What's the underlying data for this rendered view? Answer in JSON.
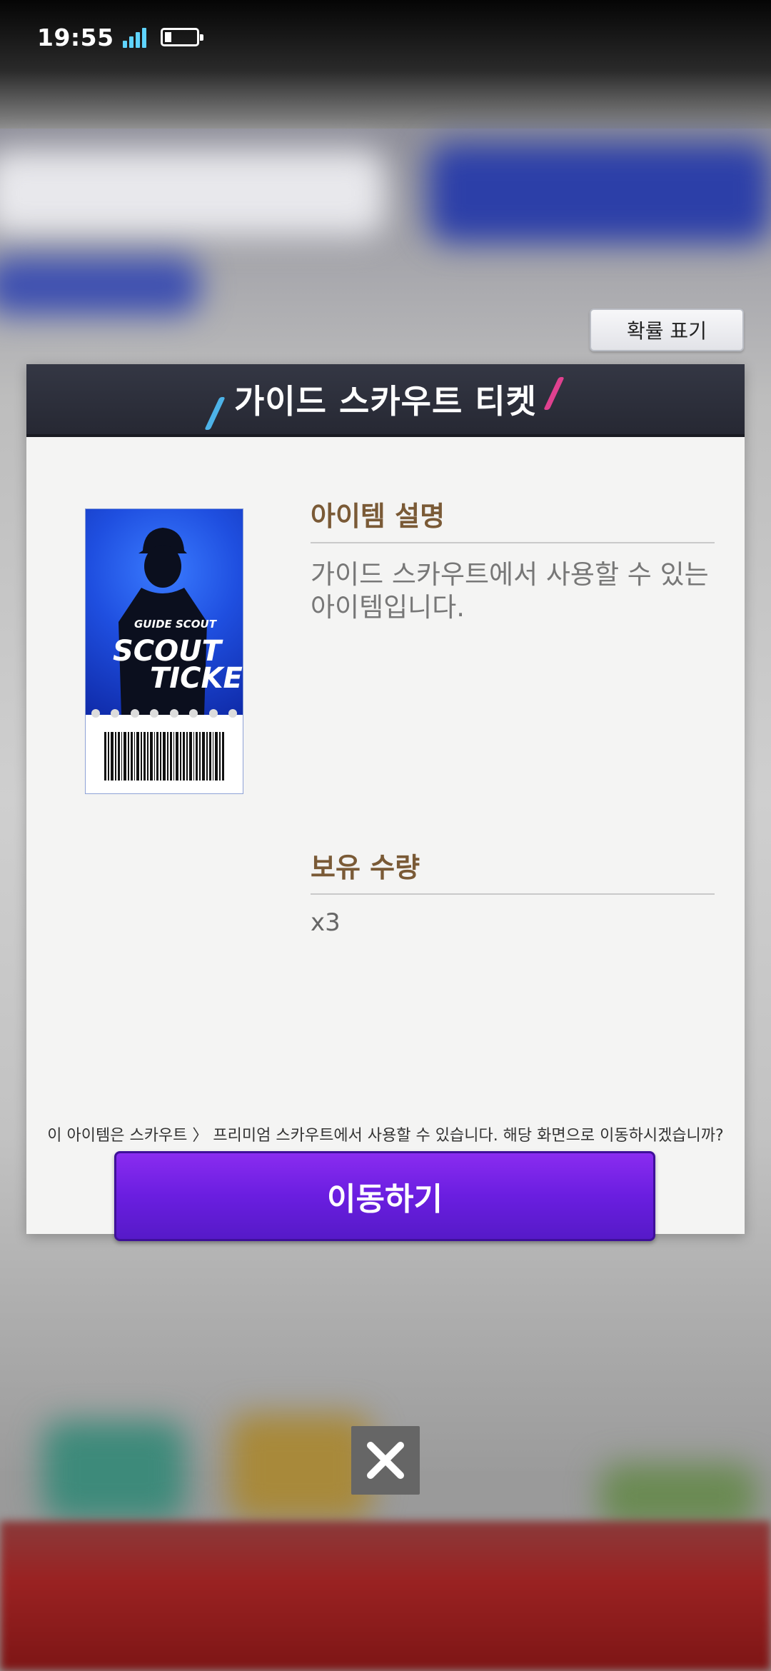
{
  "status_bar": {
    "time": "19:55"
  },
  "prob_button": {
    "label": "확률 표기"
  },
  "modal": {
    "title": "가이드 스카우트 티켓",
    "ticket_image": {
      "brand": "GUIDE SCOUT",
      "line1": "SCOUT",
      "line2": "TICKET"
    },
    "description_label": "아이템 설명",
    "description_text": "가이드 스카우트에서 사용할 수 있는 아이템입니다.",
    "quantity_label": "보유 수량",
    "quantity_value": "x3",
    "notice": "이 아이템은 스카우트 〉 프리미엄 스카우트에서 사용할 수 있습니다. 해당 화면으로 이동하시겠습니까?",
    "go_button": "이동하기"
  },
  "icons": {
    "close": "close-icon"
  },
  "colors": {
    "accent": "#6a1ee0",
    "header": "#2c2e3a",
    "label": "#7a5a36"
  }
}
